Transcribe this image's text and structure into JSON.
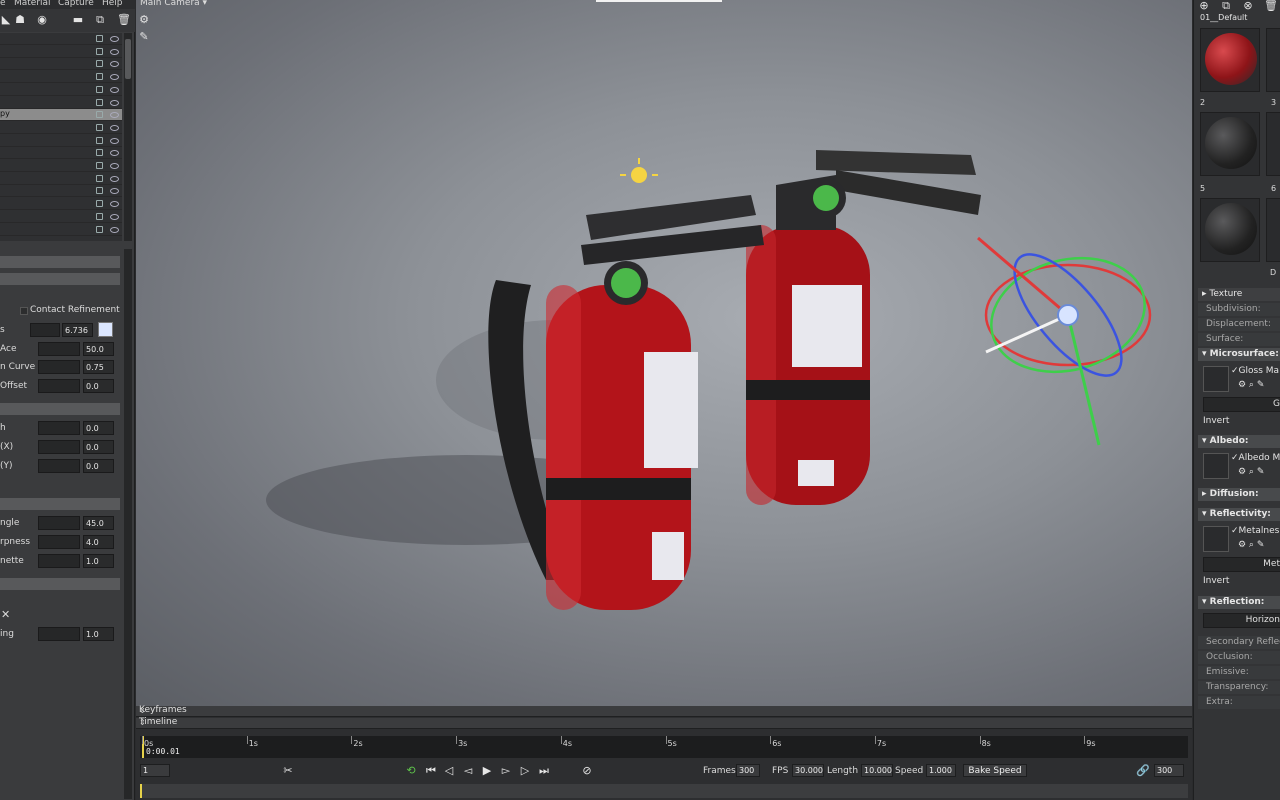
{
  "menu": [
    "e",
    "Material",
    "Capture",
    "Help"
  ],
  "viewport": {
    "camera_label": "Main Camera ▾"
  },
  "outliner": {
    "selected_label": "py",
    "rows": [
      "",
      "",
      "",
      "",
      "",
      "",
      "py",
      "",
      "",
      "",
      "",
      "",
      "",
      "",
      "",
      ""
    ]
  },
  "properties": {
    "contact_refinement": "Contact Refinement",
    "rows": [
      {
        "label": "s",
        "value": "6.736"
      },
      {
        "label": "Ace",
        "value": "50.0"
      },
      {
        "label": "n Curve",
        "value": "0.75"
      },
      {
        "label": "Offset",
        "value": "0.0"
      },
      {
        "label": "h",
        "value": "0.0"
      },
      {
        "label": "(X)",
        "value": "0.0"
      },
      {
        "label": "(Y)",
        "value": "0.0"
      },
      {
        "label": "ngle",
        "value": "45.0"
      },
      {
        "label": "rpness",
        "value": "4.0"
      },
      {
        "label": "nette",
        "value": "1.0"
      },
      {
        "label": "ing",
        "value": "1.0"
      }
    ],
    "close_glyph": "✕"
  },
  "timeline": {
    "keyframes_label": "Keyframes",
    "timeline_label": "Timeline",
    "time_readout": "0:00.01",
    "tick_labels": [
      "0s",
      "1s",
      "2s",
      "3s",
      "4s",
      "5s",
      "6s",
      "7s",
      "8s",
      "9s"
    ],
    "frame_value": "1",
    "frames_label": "Frames",
    "frames_value": "300",
    "fps_label": "FPS",
    "fps_value": "30.000",
    "length_label": "Length",
    "length_value": "10.000",
    "speed_label": "Speed",
    "speed_value": "1.000",
    "bake_speed_label": "Bake Speed",
    "end_frame_value": "300"
  },
  "materials": {
    "first_name": "01__Default",
    "numbers": [
      "2",
      "3",
      "5",
      "6"
    ],
    "end_label": "D"
  },
  "material_props": {
    "texture": "Texture",
    "subdivision": "Subdivision:",
    "displacement": "Displacement:",
    "surface": "Surface:",
    "microsurface": "Microsurface:",
    "gloss_map": "✓Gloss Ma",
    "gloss_field": "G",
    "invert": "Invert",
    "albedo": "Albedo:",
    "albedo_map": "✓Albedo M",
    "diffusion": "Diffusion:",
    "reflectivity": "Reflectivity:",
    "metalness_map": "✓Metalnes",
    "metalness_field": "Met",
    "invert2": "Invert",
    "reflection": "Reflection:",
    "horizon": "Horizon",
    "secondary_reflection": "Secondary Reflec",
    "occlusion": "Occlusion:",
    "emissive": "Emissive:",
    "transparency": "Transparency:",
    "extra": "Extra:"
  },
  "colors": {
    "extinguisher_red": "#b3141a",
    "gizmo_red": "#e03a3a",
    "gizmo_green": "#3ecf4a",
    "gizmo_blue": "#3b54e0",
    "playhead": "#e6d24a"
  }
}
